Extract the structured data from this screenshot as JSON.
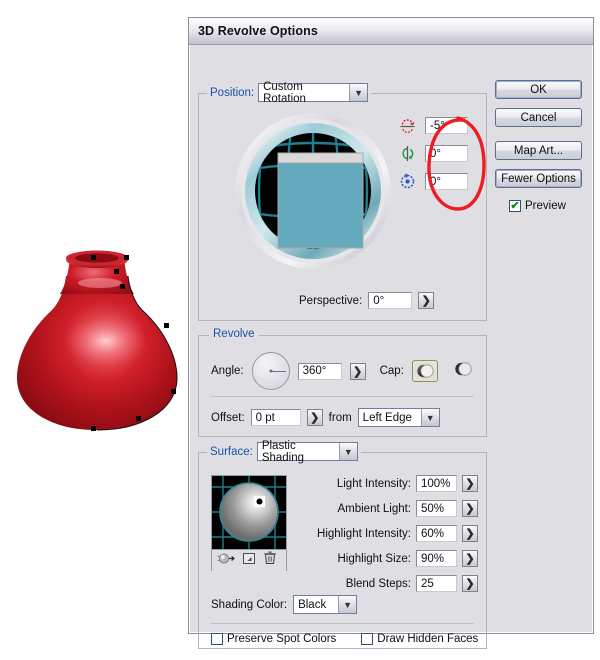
{
  "window": {
    "title": "3D Revolve Options"
  },
  "buttons": {
    "ok": "OK",
    "cancel": "Cancel",
    "map_art": "Map Art...",
    "fewer_options": "Fewer Options"
  },
  "preview": {
    "label": "Preview",
    "checked": true,
    "check_glyph": "✔"
  },
  "position": {
    "label": "Position:",
    "preset": "Custom Rotation",
    "rotations": [
      {
        "axis": "x",
        "icon": "rotate-x-icon",
        "value": "-5°",
        "color": "#cc2222"
      },
      {
        "axis": "y",
        "icon": "rotate-y-icon",
        "value": "0°",
        "color": "#199a3a"
      },
      {
        "axis": "z",
        "icon": "rotate-z-icon",
        "value": "0°",
        "color": "#2255cc"
      }
    ],
    "perspective_label": "Perspective:",
    "perspective_value": "0°"
  },
  "revolve": {
    "label": "Revolve",
    "angle_label": "Angle:",
    "angle_value": "360°",
    "cap_label": "Cap:",
    "cap_solid_name": "cap-on-icon",
    "cap_hollow_name": "cap-off-icon",
    "offset_label": "Offset:",
    "offset_value": "0 pt",
    "from_label": "from",
    "from_value": "Left Edge"
  },
  "surface": {
    "label": "Surface:",
    "shading": "Plastic Shading",
    "fields": [
      {
        "label": "Light Intensity:",
        "value": "100%"
      },
      {
        "label": "Ambient Light:",
        "value": "50%"
      },
      {
        "label": "Highlight Intensity:",
        "value": "60%"
      },
      {
        "label": "Highlight Size:",
        "value": "90%"
      },
      {
        "label": "Blend Steps:",
        "value": "25"
      }
    ],
    "light_buttons": [
      {
        "name": "new-light-icon"
      },
      {
        "name": "duplicate-light-icon"
      },
      {
        "name": "delete-light-icon"
      }
    ],
    "shading_color_label": "Shading Color:",
    "shading_color_value": "Black",
    "preserve_spot_label": "Preserve Spot Colors",
    "preserve_spot_checked": false,
    "draw_hidden_label": "Draw Hidden Faces",
    "draw_hidden_checked": false
  },
  "stepper_glyph": "❯",
  "dropdown_glyph": "▼",
  "artwork": {
    "name": "red-vase-3d-object",
    "fill": "#c8151f",
    "highlight": "#f07b84"
  },
  "annotation": {
    "name": "red-ellipse-highlight",
    "color": "#ee1c24"
  }
}
